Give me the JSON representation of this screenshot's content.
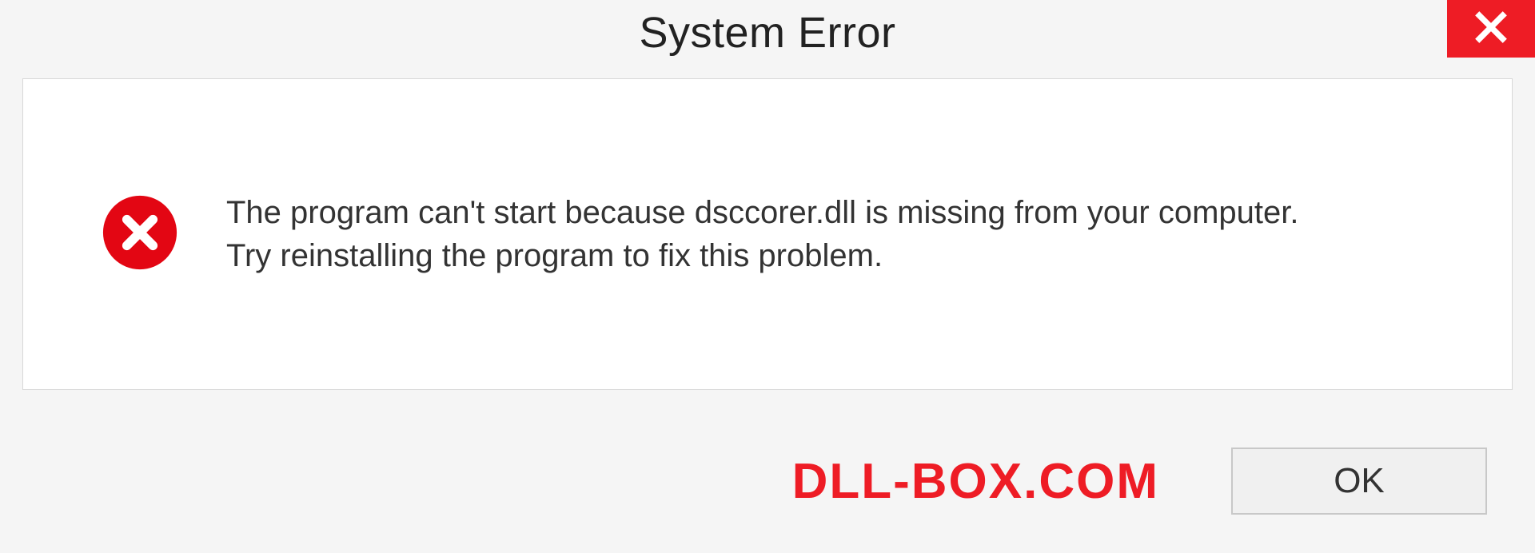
{
  "title": "System Error",
  "message": {
    "line1": "The program can't start because dsccorer.dll is missing from your computer.",
    "line2": "Try reinstalling the program to fix this problem."
  },
  "watermark": "DLL-BOX.COM",
  "ok_label": "OK",
  "colors": {
    "accent_red": "#ee1c25"
  }
}
